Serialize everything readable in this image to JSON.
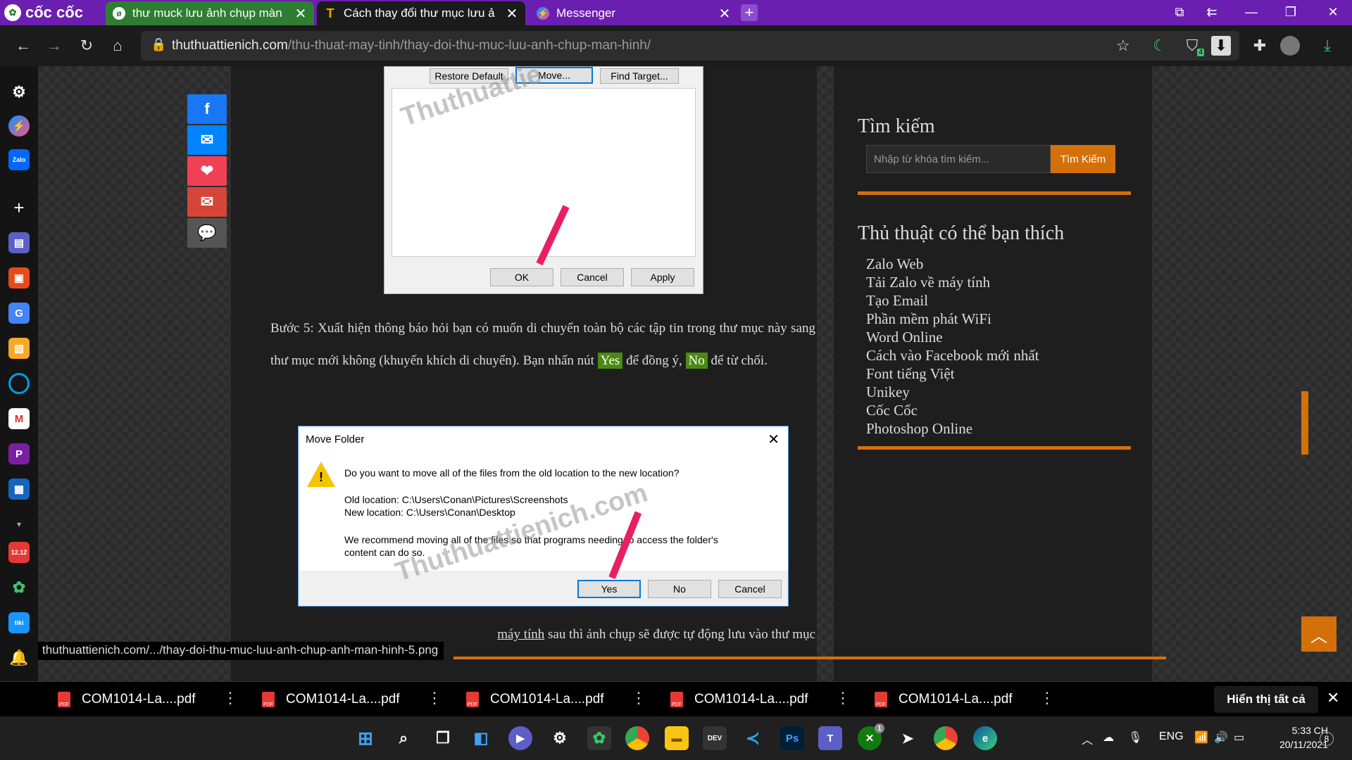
{
  "browser": {
    "brand": "cốc cốc",
    "tabs": [
      {
        "title": "thư muck lưu ảnh chụp màn",
        "close": "✕"
      },
      {
        "title": "Cách thay đổi thư mục lưu ả",
        "close": "✕"
      },
      {
        "title": "Messenger",
        "close": "✕"
      }
    ],
    "new_tab": "+",
    "url_host": "thuthuattienich.com",
    "url_path": "/thu-thuat-may-tinh/thay-doi-thu-muc-luu-anh-chup-man-hinh/",
    "shield_count": "4"
  },
  "dialog1": {
    "restore": "Restore Default",
    "move": "Move...",
    "find": "Find Target...",
    "ok": "OK",
    "cancel": "Cancel",
    "apply": "Apply",
    "watermark": "Thuthuattie"
  },
  "article": {
    "p1_a": "Bước 5: Xuất hiện thông báo hỏi bạn có muốn di chuyển toàn bộ các tập tin trong thư mục này sang thư mục mới không (khuyến khích di chuyển). Bạn nhấn nút ",
    "yes": "Yes",
    "p1_b": " để đồng ý, ",
    "no": "No",
    "p1_c": " để từ chối.",
    "p2_link": "máy tính",
    "p2_rest": "sau thì ảnh chụp sẽ được tự động lưu vào thư mục"
  },
  "dialog2": {
    "title": "Move Folder",
    "question": "Do you want to move all of the files from the old location to the new location?",
    "old": "Old location: C:\\Users\\Conan\\Pictures\\Screenshots",
    "new": "New location: C:\\Users\\Conan\\Desktop",
    "rec": "We recommend moving all of the files so that programs needing to access the folder's content can do so.",
    "yes": "Yes",
    "no": "No",
    "cancel": "Cancel",
    "watermark": "Thuthuattienich.com"
  },
  "sidebar": {
    "search_title": "Tìm kiếm",
    "search_placeholder": "Nhập từ khóa tìm kiếm...",
    "search_btn": "Tìm Kiếm",
    "tips_title": "Thủ thuật có thể bạn thích",
    "tips": [
      "Zalo Web",
      "Tải Zalo về máy tính",
      "Tạo Email",
      "Phần mềm phát WiFi",
      "Word Online",
      "Cách vào Facebook mới nhất",
      "Font tiếng Việt",
      "Unikey",
      "Cốc Cốc",
      "Photoshop Online"
    ]
  },
  "status_url": "thuthuattienich.com/.../thay-doi-thu-muc-luu-anh-chup-anh-man-hinh-5.png",
  "downloads": {
    "files": [
      "COM1014-La....pdf",
      "COM1014-La....pdf",
      "COM1014-La....pdf",
      "COM1014-La....pdf",
      "COM1014-La....pdf"
    ],
    "show_all": "Hiển thị tất cả"
  },
  "taskbar": {
    "lang": "ENG",
    "time": "5:33 CH",
    "date": "20/11/2021",
    "notif": "8",
    "xbox_badge": "1"
  },
  "left_icons": [
    "settings-icon",
    "messenger-icon",
    "zalo-icon",
    "add-icon"
  ]
}
